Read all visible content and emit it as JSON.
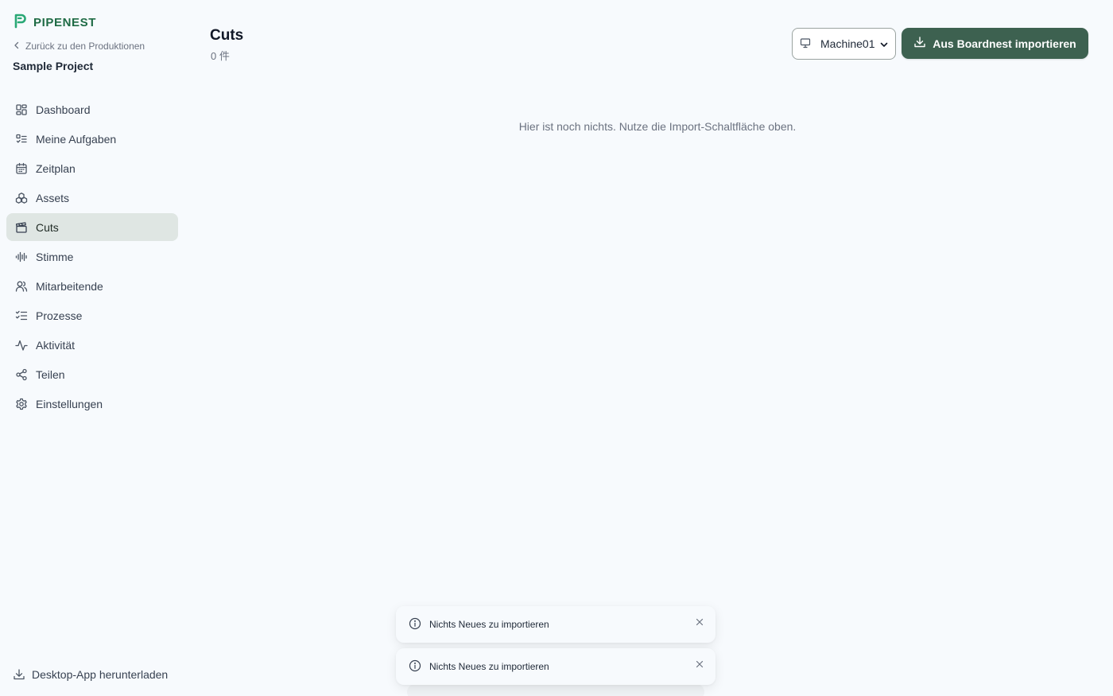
{
  "brand": {
    "name": "PIPENEST",
    "color": "#1f6b45"
  },
  "sidebar": {
    "back_label": "Zurück zu den Produktionen",
    "project_name": "Sample Project",
    "items": [
      {
        "label": "Dashboard",
        "icon": "dashboard-icon"
      },
      {
        "label": "Meine Aufgaben",
        "icon": "tasks-icon"
      },
      {
        "label": "Zeitplan",
        "icon": "calendar-icon"
      },
      {
        "label": "Assets",
        "icon": "assets-icon"
      },
      {
        "label": "Cuts",
        "icon": "clapperboard-icon",
        "active": true
      },
      {
        "label": "Stimme",
        "icon": "audio-wave-icon"
      },
      {
        "label": "Mitarbeitende",
        "icon": "users-icon"
      },
      {
        "label": "Prozesse",
        "icon": "checklist-icon"
      },
      {
        "label": "Aktivität",
        "icon": "activity-icon"
      },
      {
        "label": "Teilen",
        "icon": "share-icon"
      },
      {
        "label": "Einstellungen",
        "icon": "gear-icon"
      }
    ],
    "download_label": "Desktop-App herunterladen"
  },
  "header": {
    "title": "Cuts",
    "count": "0 件",
    "machine_select": {
      "value": "Machine01"
    },
    "import_button": "Aus Boardnest importieren"
  },
  "main": {
    "empty_message": "Hier ist noch nichts. Nutze die Import-Schaltfläche oben."
  },
  "toasts": [
    {
      "message": "Nichts Neues zu importieren"
    },
    {
      "message": "Nichts Neues zu importieren"
    }
  ],
  "colors": {
    "primary_button": "#3d6150",
    "active_nav": "#dfe6e3",
    "background": "#f7fafd"
  }
}
